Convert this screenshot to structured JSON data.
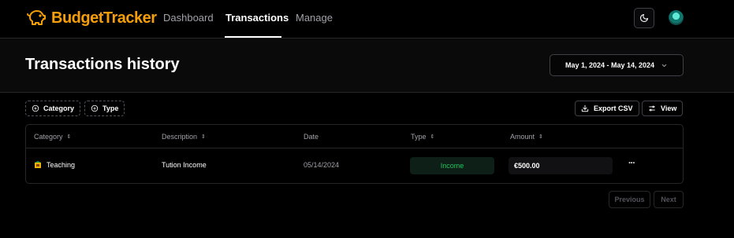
{
  "app": {
    "name": "BudgetTracker"
  },
  "nav": {
    "links": [
      {
        "label": "Dashboard",
        "active": false
      },
      {
        "label": "Transactions",
        "active": true
      },
      {
        "label": "Manage",
        "active": false
      }
    ]
  },
  "header": {
    "title": "Transactions history",
    "date_range": "May 1, 2024 - May 14, 2024"
  },
  "toolbar": {
    "filters": [
      {
        "label": "Category"
      },
      {
        "label": "Type"
      }
    ],
    "export_label": "Export CSV",
    "view_label": "View"
  },
  "table": {
    "columns": [
      {
        "label": "Category",
        "sortable": true
      },
      {
        "label": "Description",
        "sortable": true
      },
      {
        "label": "Date",
        "sortable": false
      },
      {
        "label": "Type",
        "sortable": true
      },
      {
        "label": "Amount",
        "sortable": true
      }
    ],
    "rows": [
      {
        "category": "Teaching",
        "category_icon": "school-emoji",
        "description": "Tution Income",
        "date": "05/14/2024",
        "type": "Income",
        "amount": "€500.00"
      }
    ]
  },
  "pagination": {
    "previous": "Previous",
    "next": "Next"
  },
  "colors": {
    "brand": "#f59e0b",
    "income": "#22c55e",
    "background": "#000000"
  }
}
